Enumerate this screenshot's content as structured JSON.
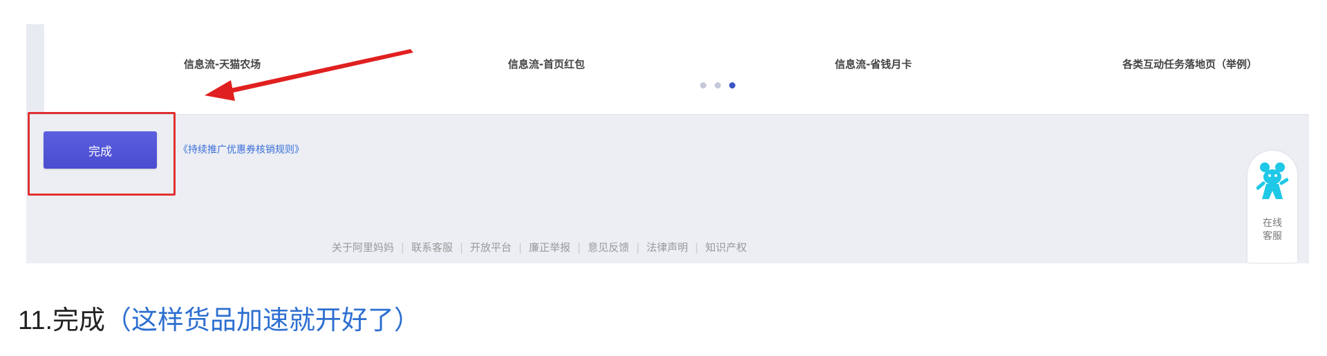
{
  "carousel": {
    "captions": [
      "信息流-天猫农场",
      "信息流-首页红包",
      "信息流-省钱月卡",
      "各类互动任务落地页（举例）"
    ],
    "dots_total": 3,
    "dots_active_index": 2
  },
  "actions": {
    "done_label": "完成",
    "rules_link": "《持续推广优惠券核销规则》"
  },
  "footer": {
    "links": [
      "关于阿里妈妈",
      "联系客服",
      "开放平台",
      "廉正举报",
      "意见反馈",
      "法律声明",
      "知识产权"
    ]
  },
  "support_widget": {
    "line1": "在线",
    "line2": "客服"
  },
  "instruction": {
    "step": "11.完成",
    "note": "（这样货品加速就开好了）"
  },
  "colors": {
    "accent": "#4a4ccf",
    "highlight": "#e03030",
    "link": "#3a6fd8",
    "note": "#2d6fd0",
    "mascot": "#1ec8e6"
  }
}
